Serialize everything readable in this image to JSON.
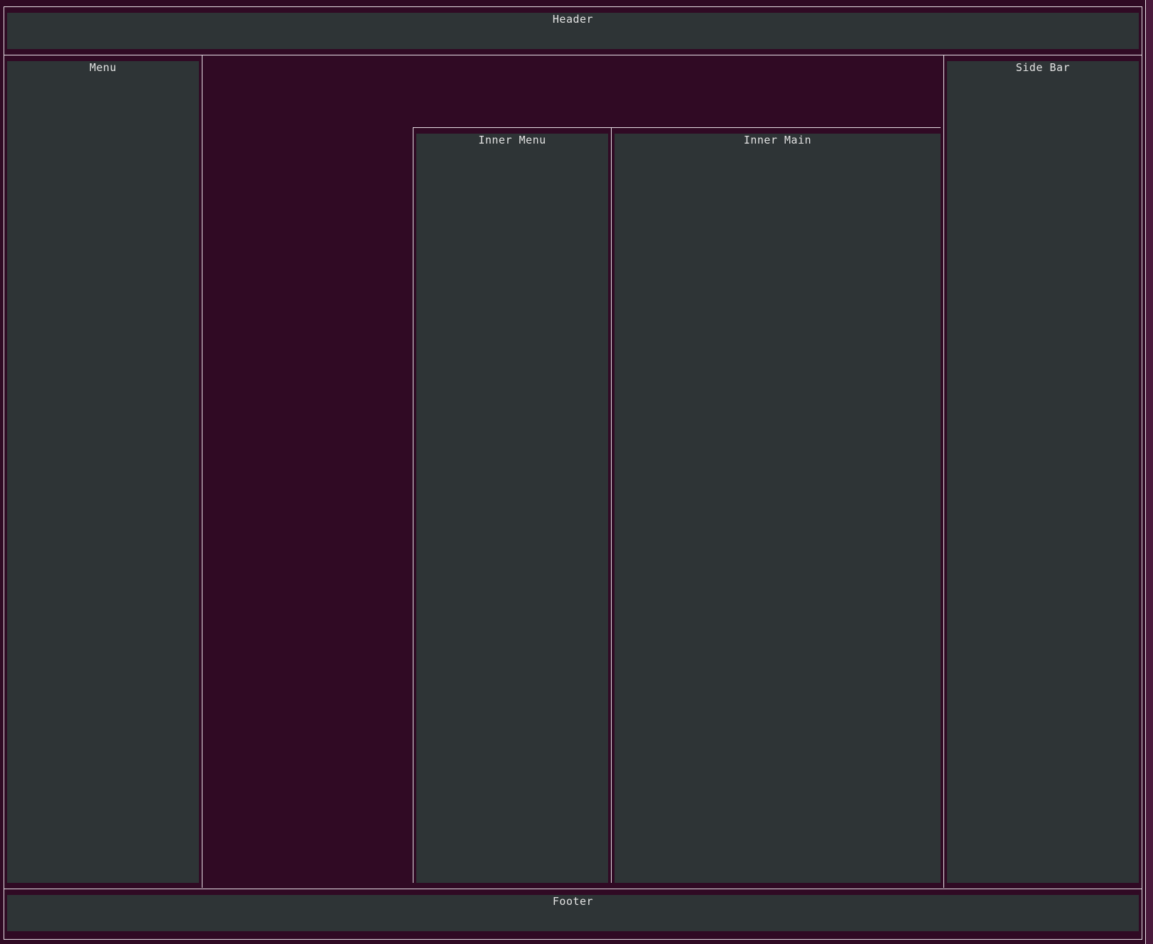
{
  "colors": {
    "background": "#300a24",
    "panel": "#2e3436",
    "border": "#e8e0e6",
    "text": "#e4e4e4"
  },
  "header": {
    "label": "Header"
  },
  "menu": {
    "label": "Menu"
  },
  "sidebar": {
    "label": "Side Bar"
  },
  "inner_menu": {
    "label": "Inner Menu"
  },
  "inner_main": {
    "label": "Inner Main"
  },
  "footer": {
    "label": "Footer"
  }
}
